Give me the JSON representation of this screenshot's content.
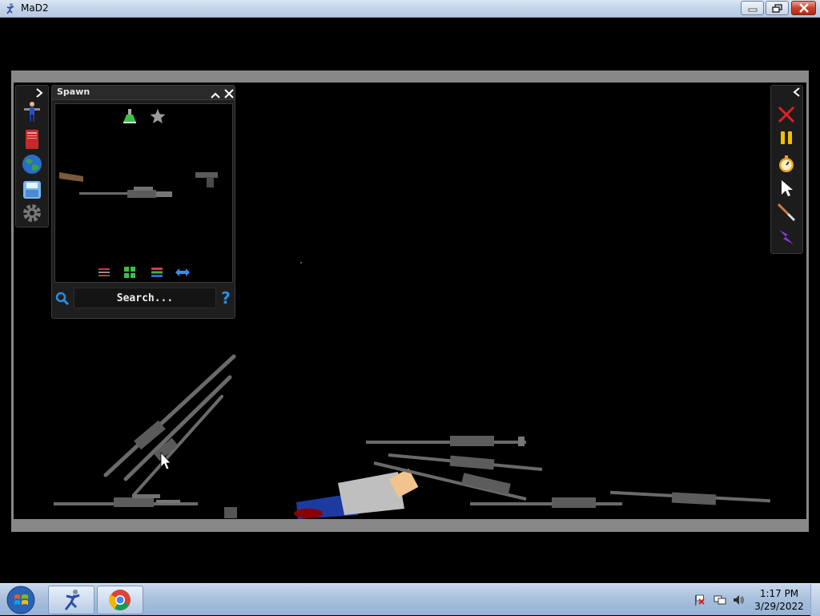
{
  "window": {
    "title": "MaD2",
    "controls": [
      "minimize",
      "maximize",
      "close"
    ]
  },
  "left_toolbar": {
    "collapse_icon": "chevron-right-icon",
    "tools": [
      "ragdoll-icon",
      "book-icon",
      "globe-icon",
      "save-icon",
      "gear-icon"
    ]
  },
  "spawn_panel": {
    "title": "Spawn",
    "category_icons": [
      "flask-icon",
      "star-icon"
    ],
    "items": [
      "rifle-stock-item",
      "sniper-rifle-item",
      "pistol-item"
    ],
    "view_icons": [
      "filter-icon",
      "grid-icon",
      "list-icon",
      "swap-icon"
    ],
    "search": {
      "placeholder": "Search...",
      "value": ""
    },
    "help_label": "?"
  },
  "right_toolbar": {
    "collapse_icon": "chevron-left-icon",
    "tools": [
      "clear-icon",
      "pause-icon",
      "timer-icon",
      "cursor-icon",
      "knife-icon",
      "lightning-icon"
    ]
  },
  "taskbar": {
    "pinned": [
      "mad2-app",
      "chrome"
    ],
    "tray": [
      "flag-icon",
      "network-icon",
      "volume-icon"
    ],
    "time": "1:17 PM",
    "date": "3/29/2022"
  },
  "colors": {
    "frame": "#888888",
    "stage": "#000000",
    "panel": "#1e1e1e",
    "close_red": "#e02020",
    "pause_yellow": "#f0c000",
    "help_blue": "#2a8ee0"
  }
}
